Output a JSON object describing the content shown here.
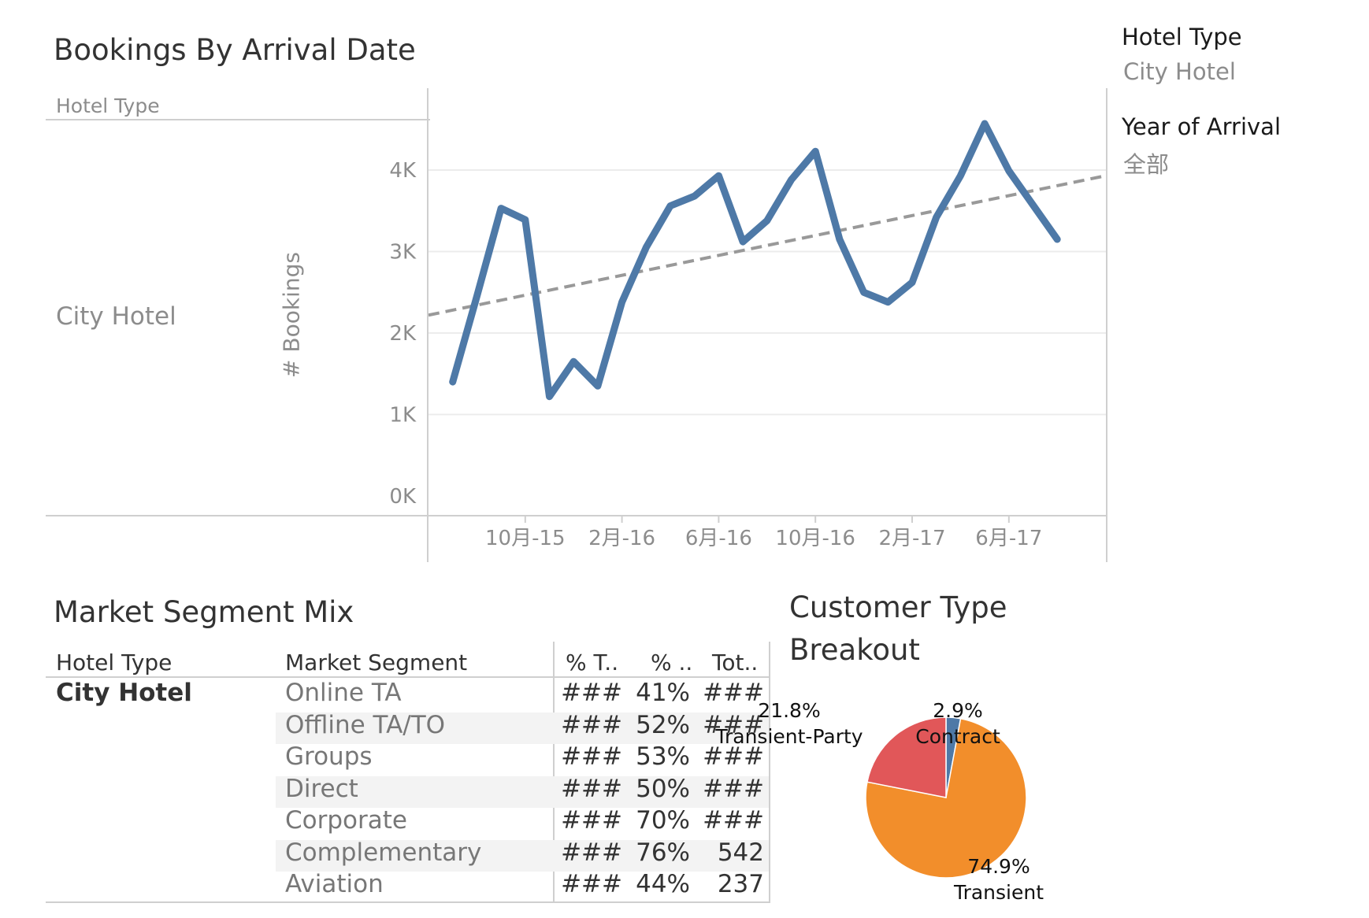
{
  "line_chart": {
    "title": "Bookings By Arrival Date",
    "row_header": "Hotel Type",
    "row_value": "City Hotel",
    "y_axis_label": "# Bookings"
  },
  "filters": {
    "hotel_type_title": "Hotel Type",
    "hotel_type_value": "City Hotel",
    "year_title": "Year of Arrival",
    "year_value": "全部"
  },
  "table": {
    "title": "Market Segment Mix",
    "headers": [
      "Hotel Type",
      "Market Segment",
      "% T..",
      "% ..",
      "Tot.."
    ],
    "hotel": "City Hotel",
    "rows": [
      {
        "segment": "Online TA",
        "c1": "###",
        "c2": "41%",
        "c3": "###"
      },
      {
        "segment": "Offline TA/TO",
        "c1": "###",
        "c2": "52%",
        "c3": "###"
      },
      {
        "segment": "Groups",
        "c1": "###",
        "c2": "53%",
        "c3": "###"
      },
      {
        "segment": "Direct",
        "c1": "###",
        "c2": "50%",
        "c3": "###"
      },
      {
        "segment": "Corporate",
        "c1": "###",
        "c2": "70%",
        "c3": "###"
      },
      {
        "segment": "Complementary",
        "c1": "###",
        "c2": "76%",
        "c3": "542"
      },
      {
        "segment": "Aviation",
        "c1": "###",
        "c2": "44%",
        "c3": "237"
      }
    ]
  },
  "pie": {
    "title_line1": "Customer Type",
    "title_line2": "Breakout"
  },
  "chart_data": [
    {
      "type": "line",
      "title": "Bookings By Arrival Date",
      "ylabel": "# Bookings",
      "xlabel": "",
      "ylim": [
        0,
        4800
      ],
      "yticks": [
        "0K",
        "1K",
        "2K",
        "3K",
        "4K"
      ],
      "xticks": [
        "10月-15",
        "2月-16",
        "6月-16",
        "10月-16",
        "2月-17",
        "6月-17"
      ],
      "grid": true,
      "series": [
        {
          "values": [
            {
              "x": "2015-07",
              "y": 1400
            },
            {
              "x": "2015-08",
              "y": 2450
            },
            {
              "x": "2015-09",
              "y": 3530
            },
            {
              "x": "2015-10",
              "y": 3390
            },
            {
              "x": "2015-11",
              "y": 1220
            },
            {
              "x": "2015-12",
              "y": 1650
            },
            {
              "x": "2016-01",
              "y": 1350
            },
            {
              "x": "2016-02",
              "y": 2380
            },
            {
              "x": "2016-03",
              "y": 3050
            },
            {
              "x": "2016-04",
              "y": 3560
            },
            {
              "x": "2016-05",
              "y": 3680
            },
            {
              "x": "2016-06",
              "y": 3930
            },
            {
              "x": "2016-07",
              "y": 3120
            },
            {
              "x": "2016-08",
              "y": 3380
            },
            {
              "x": "2016-09",
              "y": 3880
            },
            {
              "x": "2016-10",
              "y": 4230
            },
            {
              "x": "2016-11",
              "y": 3150
            },
            {
              "x": "2016-12",
              "y": 2500
            },
            {
              "x": "2017-01",
              "y": 2380
            },
            {
              "x": "2017-02",
              "y": 2620
            },
            {
              "x": "2017-03",
              "y": 3420
            },
            {
              "x": "2017-04",
              "y": 3930
            },
            {
              "x": "2017-05",
              "y": 4570
            },
            {
              "x": "2017-06",
              "y": 3990
            },
            {
              "x": "2017-07",
              "y": 3570
            },
            {
              "x": "2017-08",
              "y": 3150
            }
          ]
        }
      ],
      "trend_line": {
        "x0": "2015-06",
        "y0": 2220,
        "x1": "2017-10",
        "y1": 3930
      },
      "colors": {
        "line": "#4e79a7",
        "trend": "#999999",
        "grid": "#ececec"
      }
    },
    {
      "type": "pie",
      "title": "Customer Type Breakout",
      "slices": [
        {
          "label": "Contract",
          "value": 2.9,
          "display": "2.9%",
          "color": "#4e79a7"
        },
        {
          "label": "Transient",
          "value": 74.9,
          "display": "74.9%",
          "color": "#f28e2b"
        },
        {
          "label": "Transient-Party",
          "value": 21.8,
          "display": "21.8%",
          "color": "#e15759"
        }
      ]
    }
  ]
}
